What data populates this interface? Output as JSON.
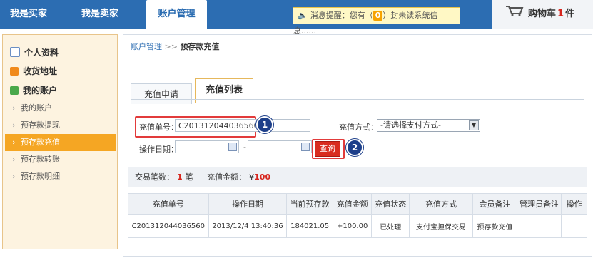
{
  "nav": {
    "buyer": "我是买家",
    "seller": "我是卖家",
    "account": "账户管理"
  },
  "message": {
    "prefix": "消息提醒：您有（",
    "count": "0",
    "suffix": "）封未读系统信息......"
  },
  "cart": {
    "label": "购物车",
    "count": "1",
    "unit": "件"
  },
  "sidebar": {
    "items": [
      {
        "label": "个人资料",
        "icon": "profile-icon"
      },
      {
        "label": "收货地址",
        "icon": "heart-icon"
      },
      {
        "label": "我的账户",
        "icon": "account-icon"
      }
    ],
    "subitems": [
      {
        "label": "我的账户"
      },
      {
        "label": "预存款提现"
      },
      {
        "label": "预存款充值"
      },
      {
        "label": "预存款转账"
      },
      {
        "label": "预存款明细"
      }
    ]
  },
  "breadcrumb": {
    "root": "账户管理",
    "sep": ">>",
    "current": "预存款充值"
  },
  "tabs": [
    {
      "label": "充值申请"
    },
    {
      "label": "充值列表"
    }
  ],
  "form": {
    "order_label": "充值单号：",
    "order_value": "C201312044036560",
    "pay_label": "充值方式：",
    "pay_value": "-请选择支付方式-",
    "date_label": "操作日期：",
    "date_sep": "-",
    "query_label": "查询"
  },
  "callouts": [
    "1",
    "2"
  ],
  "summary": {
    "count_label": "交易笔数：",
    "count": "1",
    "count_unit": "笔",
    "amount_label": "充值金额：",
    "currency": "¥",
    "amount": "100"
  },
  "table": {
    "headers": [
      "充值单号",
      "操作日期",
      "当前预存款",
      "充值金额",
      "充值状态",
      "充值方式",
      "会员备注",
      "管理员备注",
      "操作"
    ],
    "rows": [
      [
        "C201312044036560",
        "2013/12/4 13:40:36",
        "184021.05",
        "+100.00",
        "已处理",
        "支付宝担保交易",
        "预存款充值",
        "",
        ""
      ]
    ]
  }
}
